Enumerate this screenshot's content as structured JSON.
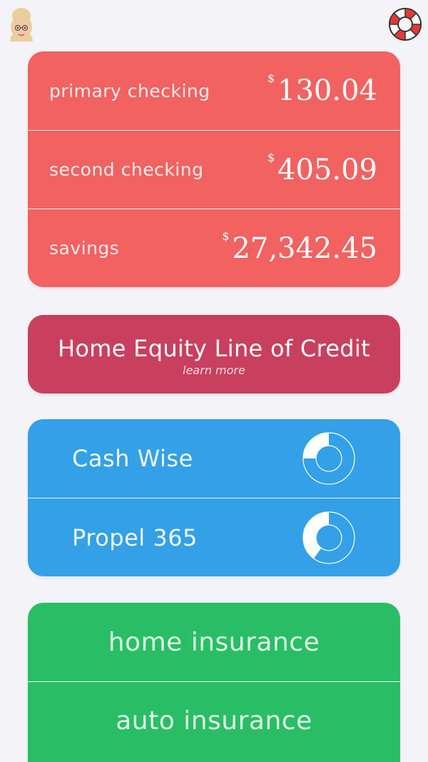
{
  "colors": {
    "background": "#f4f3f7",
    "accounts": "#f16261",
    "heloc": "#c8405e",
    "goals": "#33a0e8",
    "insurance": "#29be65"
  },
  "header": {
    "avatar_icon": "user-avatar-icon",
    "help_icon": "lifebuoy-icon"
  },
  "accounts": [
    {
      "name": "primary checking",
      "currency": "$",
      "amount": "130.04"
    },
    {
      "name": "second checking",
      "currency": "$",
      "amount": "405.09"
    },
    {
      "name": "savings",
      "currency": "$",
      "amount": "27,342.45"
    }
  ],
  "heloc": {
    "title": "Home Equity Line of Credit",
    "link": "learn more"
  },
  "goals": [
    {
      "name": "Cash Wise",
      "progress": 0.25
    },
    {
      "name": "Propel 365",
      "progress": 0.4
    }
  ],
  "insurance": [
    {
      "label": "home insurance"
    },
    {
      "label": "auto insurance"
    }
  ]
}
